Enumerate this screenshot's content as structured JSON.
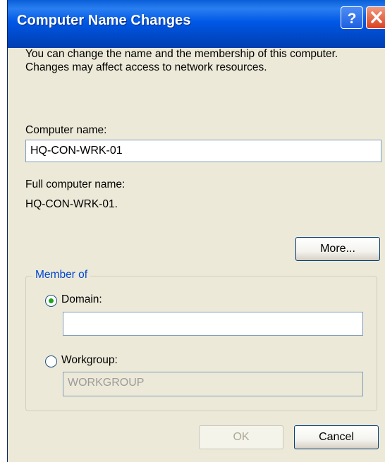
{
  "window": {
    "title": "Computer Name Changes",
    "help_glyph": "?",
    "description": "You can change the name and the membership of this computer. Changes may affect access to network resources."
  },
  "computer_name": {
    "label": "Computer name:",
    "value": "HQ-CON-WRK-01"
  },
  "full_name": {
    "label": "Full computer name:",
    "value": "HQ-CON-WRK-01."
  },
  "more_button": "More...",
  "member_of": {
    "legend": "Member of",
    "domain": {
      "label": "Domain:",
      "selected": true,
      "value": ""
    },
    "workgroup": {
      "label": "Workgroup:",
      "selected": false,
      "placeholder": "WORKGROUP"
    }
  },
  "buttons": {
    "ok": "OK",
    "cancel": "Cancel"
  },
  "colors": {
    "titlebar": "#0058e6",
    "window_bg": "#ece9d8",
    "legend_text": "#0046d5",
    "radio_dot": "#21a121"
  },
  "icons": {
    "help": "question-mark-icon",
    "close": "close-x-icon"
  }
}
